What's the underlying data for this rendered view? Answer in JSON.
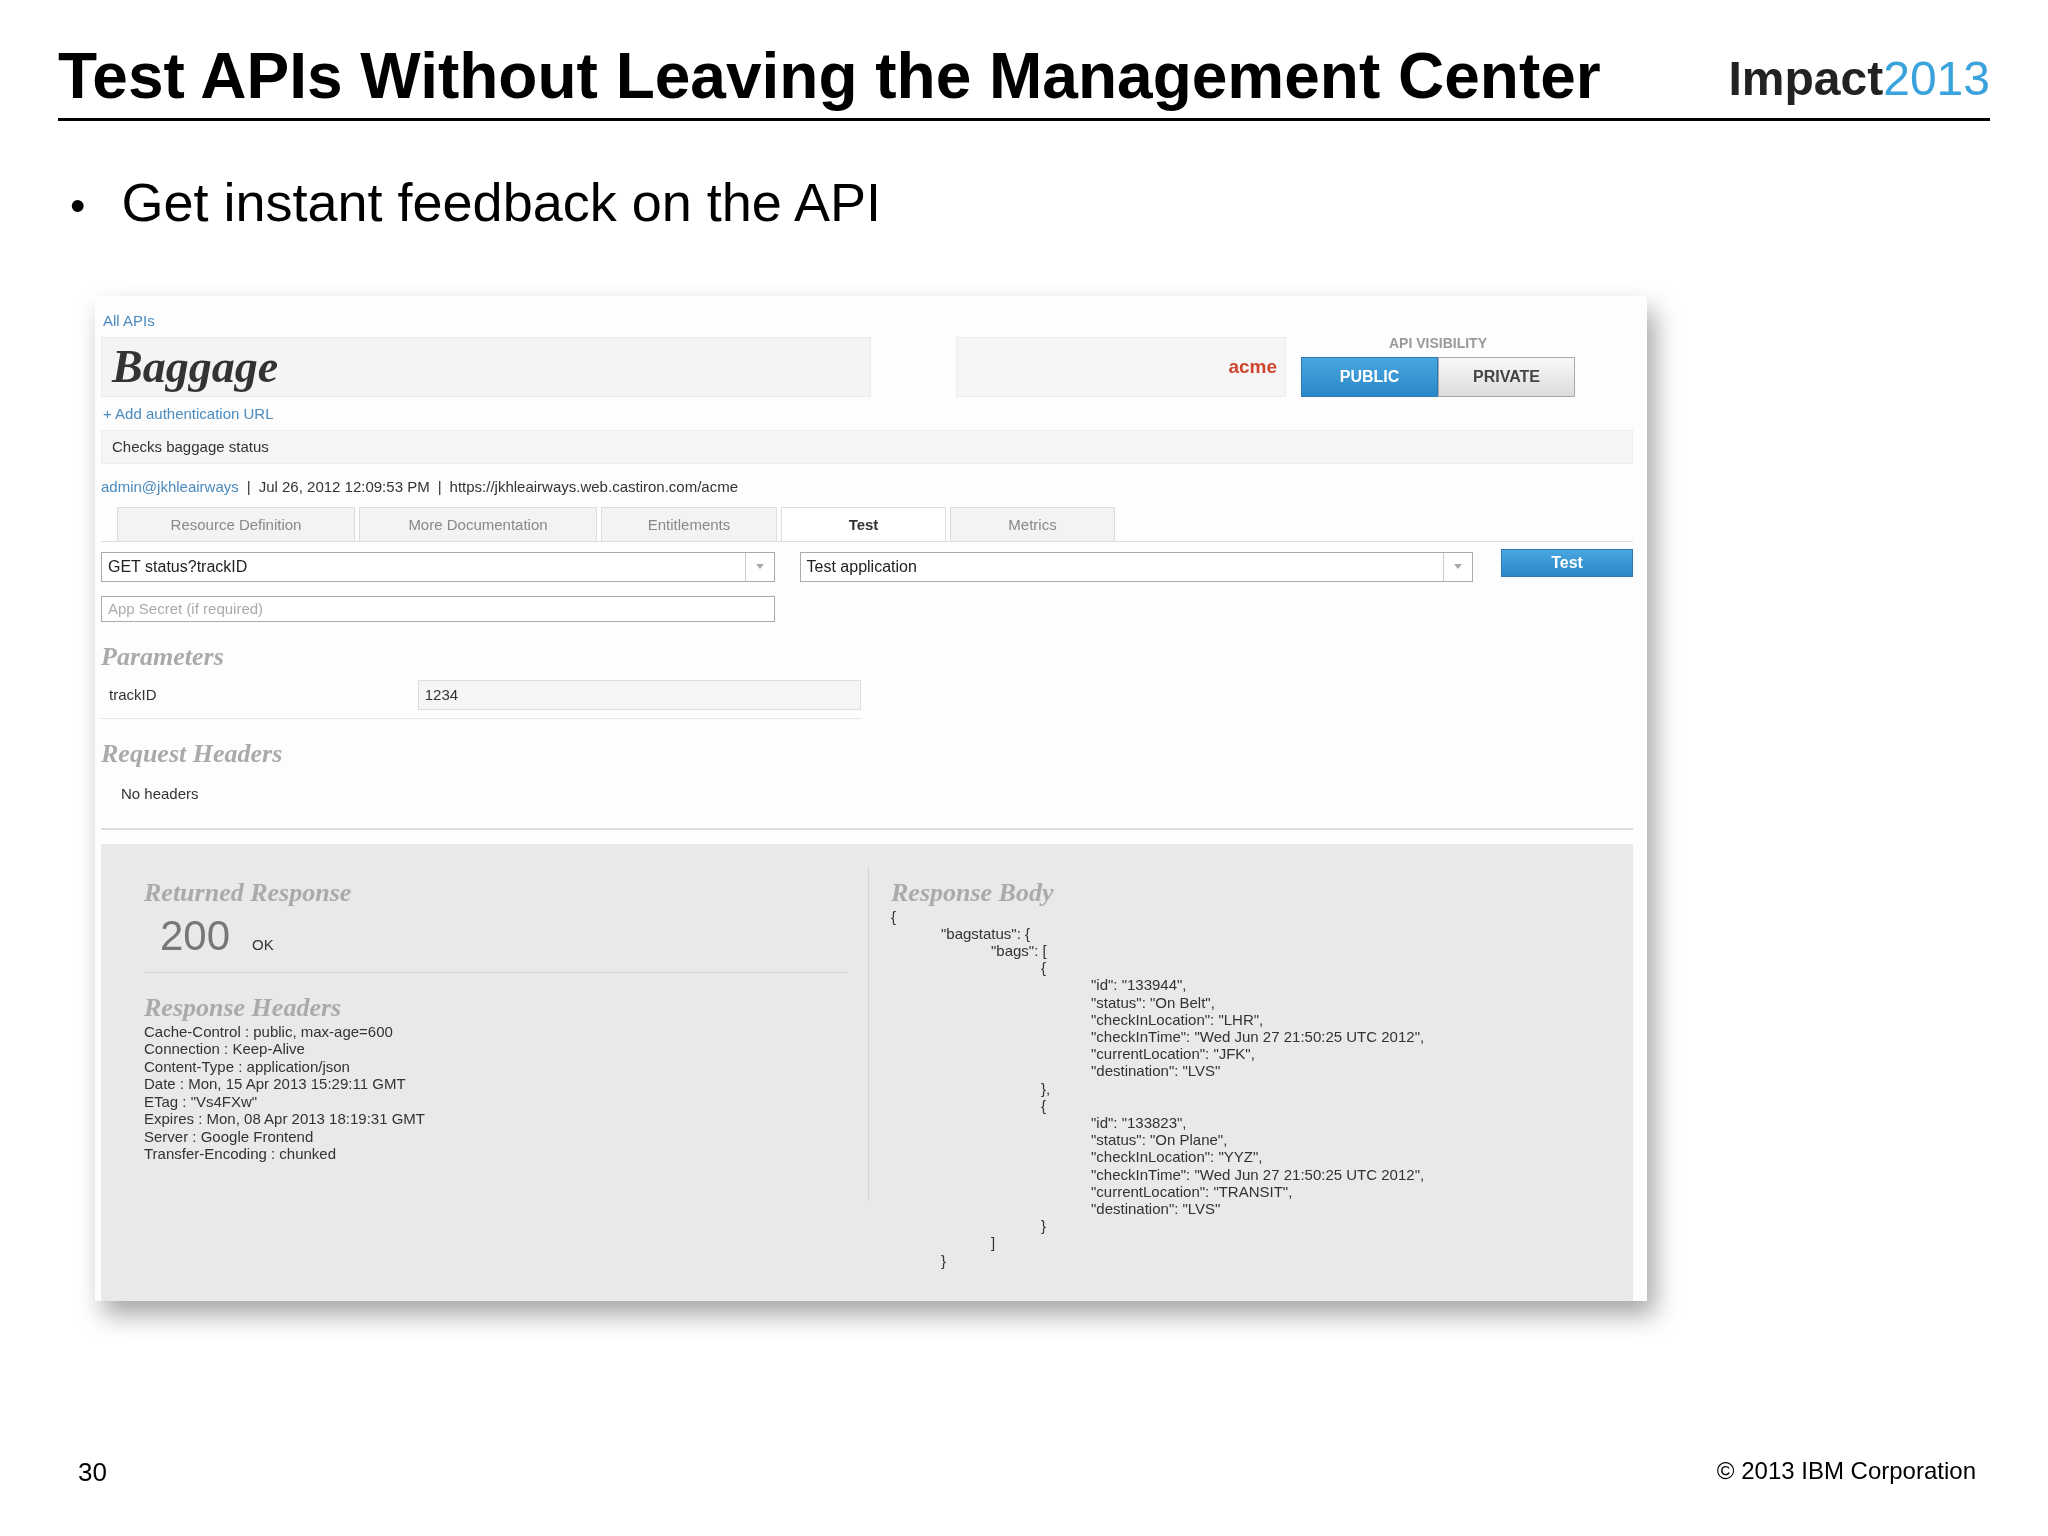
{
  "slide": {
    "title": "Test APIs Without Leaving the Management Center",
    "logo": {
      "word": "Impact",
      "year": "2013"
    },
    "bullets": [
      {
        "mark": "•",
        "text": "Get instant feedback on the API"
      }
    ],
    "page_number": "30",
    "copyright": "© 2013 IBM Corporation"
  },
  "app": {
    "breadcrumb": "All APIs",
    "api_name": "Baggage",
    "owner": "acme",
    "visibility": {
      "label": "API VISIBILITY",
      "options": [
        {
          "label": "PUBLIC",
          "selected": true
        },
        {
          "label": "PRIVATE",
          "selected": false
        }
      ]
    },
    "add_auth_link": "+ Add authentication URL",
    "description": "Checks baggage status",
    "meta": [
      {
        "kind": "link",
        "text": "admin@jkhleairways"
      },
      {
        "kind": "separator",
        "text": "|"
      },
      {
        "kind": "text",
        "text": "Jul 26, 2012 12:09:53 PM"
      },
      {
        "kind": "separator",
        "text": "|"
      },
      {
        "kind": "text",
        "text": "https://jkhleairways.web.castiron.com/acme"
      }
    ],
    "tabs": [
      {
        "label": "Resource Definition",
        "selected": false
      },
      {
        "label": "More Documentation",
        "selected": false
      },
      {
        "label": "Entitlements",
        "selected": false
      },
      {
        "label": "Test",
        "selected": true
      },
      {
        "label": "Metrics",
        "selected": false
      }
    ],
    "resource_select": {
      "value": "GET status?trackID"
    },
    "application_select": {
      "value": "Test application"
    },
    "test_button": "Test",
    "app_secret": {
      "placeholder": "App Secret (if required)"
    },
    "parameters": {
      "title": "Parameters",
      "rows": [
        {
          "name": "trackID",
          "value": "1234"
        }
      ]
    },
    "request_headers": {
      "title": "Request Headers",
      "empty_text": "No headers"
    },
    "response": {
      "title": "Returned Response",
      "status_code": "200",
      "status_text": "OK",
      "headers_title": "Response Headers",
      "headers": [
        "Cache-Control : public, max-age=600",
        "Connection : Keep-Alive",
        "Content-Type : application/json",
        "Date : Mon, 15 Apr 2013 15:29:11 GMT",
        "ETag : \"Vs4FXw\"",
        "Expires : Mon, 08 Apr 2013 18:19:31 GMT",
        "Server : Google Frontend",
        "Transfer-Encoding : chunked"
      ],
      "body_title": "Response Body",
      "body": [
        {
          "text": "{",
          "children": [
            {
              "text": "\"bagstatus\": {",
              "children": [
                {
                  "text": "\"bags\": [",
                  "children": [
                    {
                      "text": "{",
                      "children": [
                        {
                          "text": "\"id\": \"133944\","
                        },
                        {
                          "text": "\"status\": \"On Belt\","
                        },
                        {
                          "text": "\"checkInLocation\": \"LHR\","
                        },
                        {
                          "text": "\"checkInTime\": \"Wed Jun 27 21:50:25 UTC 2012\","
                        },
                        {
                          "text": "\"currentLocation\": \"JFK\","
                        },
                        {
                          "text": "\"destination\": \"LVS\""
                        }
                      ]
                    },
                    {
                      "text": "},"
                    },
                    {
                      "text": "{",
                      "children": [
                        {
                          "text": "\"id\": \"133823\","
                        },
                        {
                          "text": "\"status\": \"On Plane\","
                        },
                        {
                          "text": "\"checkInLocation\": \"YYZ\","
                        },
                        {
                          "text": "\"checkInTime\": \"Wed Jun 27 21:50:25 UTC 2012\","
                        },
                        {
                          "text": "\"currentLocation\": \"TRANSIT\","
                        },
                        {
                          "text": "\"destination\": \"LVS\""
                        }
                      ]
                    },
                    {
                      "text": "}"
                    }
                  ]
                },
                {
                  "text": "]"
                }
              ]
            },
            {
              "text": "}"
            }
          ]
        }
      ]
    }
  }
}
